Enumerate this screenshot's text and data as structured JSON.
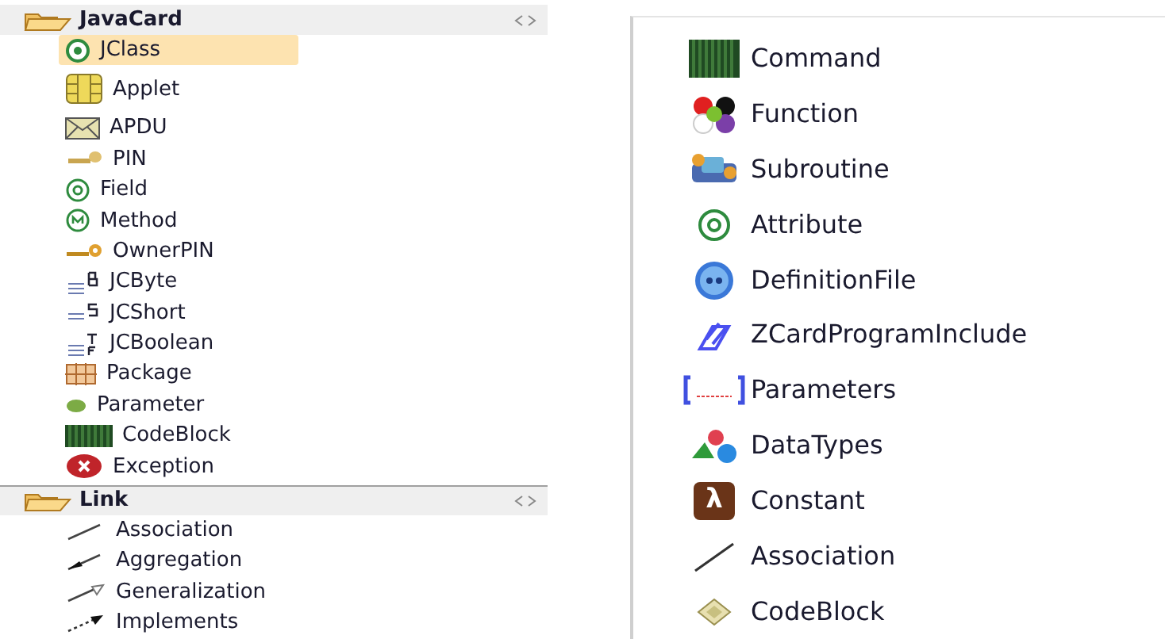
{
  "palette": {
    "groups": [
      {
        "title": "JavaCard",
        "items": [
          {
            "label": "JClass",
            "selected": true
          },
          {
            "label": "Applet",
            "selected": false
          },
          {
            "label": "APDU",
            "selected": false
          },
          {
            "label": "PIN",
            "selected": false
          },
          {
            "label": "Field",
            "selected": false
          },
          {
            "label": "Method",
            "selected": false
          },
          {
            "label": "OwnerPIN",
            "selected": false
          },
          {
            "label": "JCByte",
            "selected": false
          },
          {
            "label": "JCShort",
            "selected": false
          },
          {
            "label": "JCBoolean",
            "selected": false
          },
          {
            "label": "Package",
            "selected": false
          },
          {
            "label": "Parameter",
            "selected": false
          },
          {
            "label": "CodeBlock",
            "selected": false
          },
          {
            "label": "Exception",
            "selected": false
          }
        ]
      },
      {
        "title": "Link",
        "items": [
          {
            "label": "Association",
            "selected": false
          },
          {
            "label": "Aggregation",
            "selected": false
          },
          {
            "label": "Generalization",
            "selected": false
          },
          {
            "label": "Implements",
            "selected": false
          }
        ]
      }
    ]
  },
  "toolbox": {
    "items": [
      {
        "label": "Command"
      },
      {
        "label": "Function"
      },
      {
        "label": "Subroutine"
      },
      {
        "label": "Attribute"
      },
      {
        "label": "DefinitionFile"
      },
      {
        "label": "ZCardProgramInclude"
      },
      {
        "label": "Parameters"
      },
      {
        "label": "DataTypes"
      },
      {
        "label": "Constant",
        "icon_glyph": "λ"
      },
      {
        "label": "Association"
      },
      {
        "label": "CodeBlock"
      }
    ]
  }
}
